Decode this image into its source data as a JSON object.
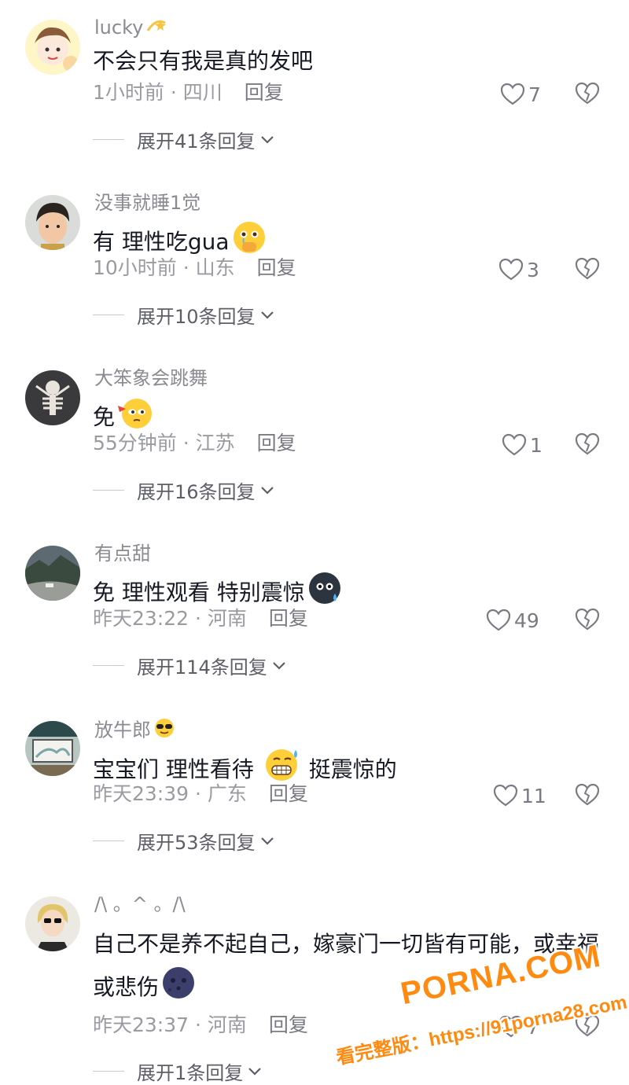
{
  "comments": [
    {
      "username": "lucky",
      "username_emoji": "dizzy-star-emoji",
      "text": "不会只有我是真的发吧",
      "text_emoji": "",
      "meta": "1小时前 · 四川",
      "reply_label": "回复",
      "likes": "7",
      "expand": "展开41条回复"
    },
    {
      "username": "没事就睡1觉",
      "username_emoji": "",
      "text": "有 理性吃gua",
      "text_emoji": "holding-back-tears-emoji",
      "meta": "10小时前 · 山东",
      "reply_label": "回复",
      "likes": "3",
      "expand": "展开10条回复"
    },
    {
      "username": "大笨象会跳舞",
      "username_emoji": "",
      "text": "免",
      "text_emoji": "eyes-emoji",
      "meta": "55分钟前 · 江苏",
      "reply_label": "回复",
      "likes": "1",
      "expand": "展开16条回复"
    },
    {
      "username": "有点甜",
      "username_emoji": "",
      "text": "免 理性观看 特别震惊",
      "text_emoji": "sweat-dark-emoji",
      "meta": "昨天23:22 · 河南",
      "reply_label": "回复",
      "likes": "49",
      "expand": "展开114条回复"
    },
    {
      "username": "放牛郎",
      "username_emoji": "sunglasses-emoji",
      "text": "宝宝们 理性看待 ",
      "text_emoji": "grimacing-sweat-emoji",
      "text_after": " 挺震惊的",
      "meta": "昨天23:39 · 广东",
      "reply_label": "回复",
      "likes": "11",
      "expand": "展开53条回复"
    },
    {
      "username": "/\\ 。^ 。/\\",
      "username_emoji": "",
      "text": "自己不是养不起自己，嫁豪门一切皆有可能，或幸福或悲伤",
      "text_emoji": "dark-moon-face-emoji",
      "meta": "昨天23:37 · 河南",
      "reply_label": "回复",
      "likes": "7",
      "expand": "展开1条回复"
    }
  ],
  "watermark": {
    "brand": "PORNA.COM",
    "url_line": "看完整版：https://91porna28.com"
  },
  "colors": {
    "text": "#161823",
    "meta": "#9a9ba1",
    "watermark": "#ff8a10"
  }
}
